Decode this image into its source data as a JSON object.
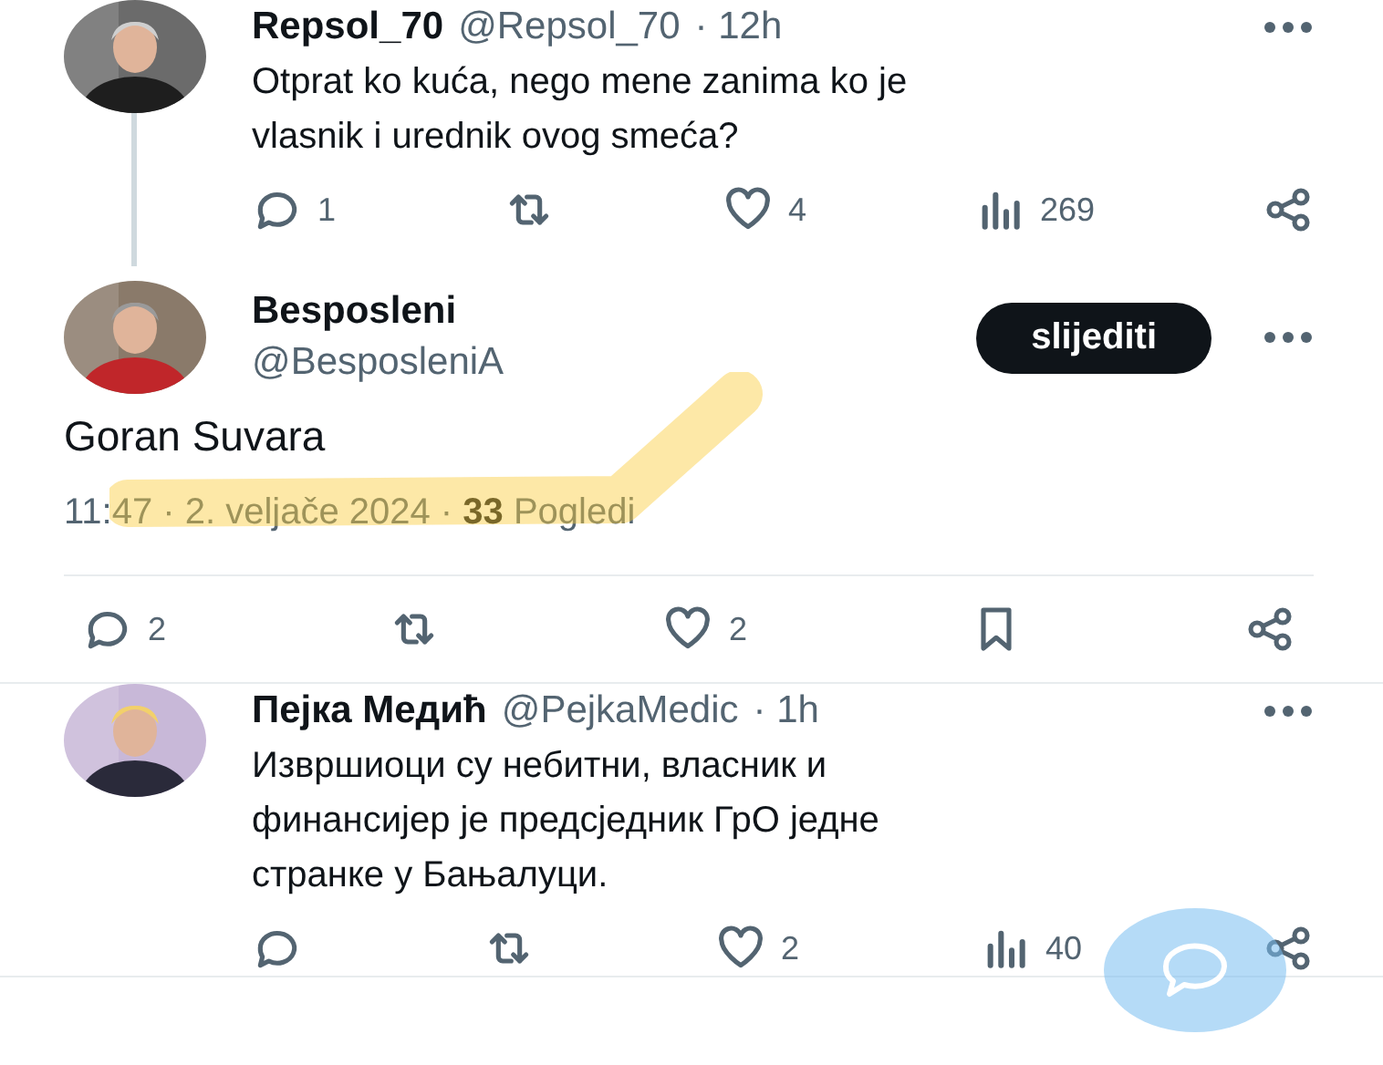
{
  "tweets": [
    {
      "kind": "reply",
      "name": "Repsol_70",
      "handle": "@Repsol_70",
      "time": "· 12h",
      "text": "Otprat ko kuća, nego mene zanima ko je vlasnik i urednik ovog smeća?",
      "thread_line": true,
      "actions": [
        {
          "kind": "reply",
          "count": "1"
        },
        {
          "kind": "repost"
        },
        {
          "kind": "like",
          "count": "4"
        },
        {
          "kind": "views",
          "count": "269"
        },
        {
          "kind": "share"
        }
      ]
    },
    {
      "kind": "main",
      "name": "Besposleni",
      "handle": "@BesposleniA",
      "follow_button": "slijediti",
      "text": "Goran Suvara",
      "meta": "11:47 · 2. veljače 2024 · **33** Pogledi",
      "highlighted": true,
      "actions": [
        {
          "kind": "reply",
          "count": "2"
        },
        {
          "kind": "repost"
        },
        {
          "kind": "like",
          "count": "2"
        },
        {
          "kind": "bookmark"
        },
        {
          "kind": "share"
        }
      ]
    },
    {
      "kind": "reply",
      "name": "Пејка Медић",
      "handle": "@PejkaMedic",
      "time": "· 1h",
      "text": "Извршиоци су небитни, власник и финансијер је предсједник ГрО једне странке у Бањалуци.",
      "thread_line": false,
      "actions": [
        {
          "kind": "reply"
        },
        {
          "kind": "repost"
        },
        {
          "kind": "like",
          "count": "2"
        },
        {
          "kind": "views",
          "count": "40"
        },
        {
          "kind": "share"
        }
      ]
    }
  ],
  "compose_button": {
    "visible": true
  }
}
